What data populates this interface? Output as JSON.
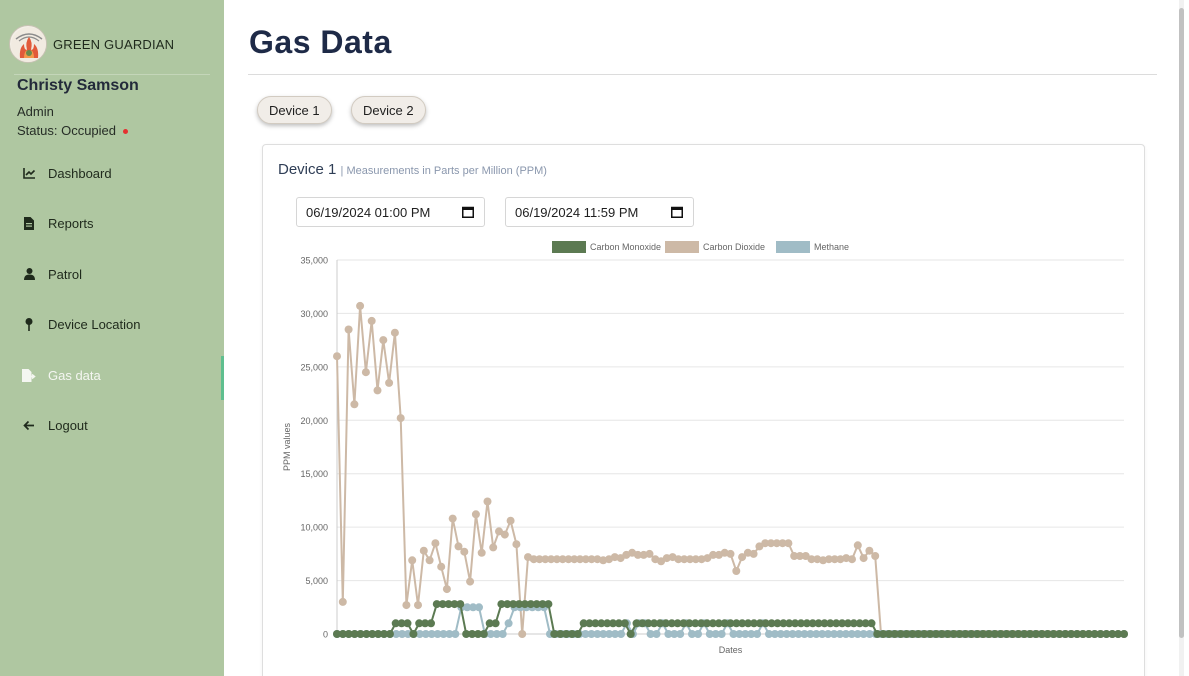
{
  "brand": {
    "name": "GREEN GUARDIAN"
  },
  "user": {
    "name": "Christy Samson",
    "role": "Admin",
    "status": "Status: Occupied"
  },
  "nav": [
    {
      "label": "Dashboard",
      "icon": "chart-line-icon"
    },
    {
      "label": "Reports",
      "icon": "document-icon"
    },
    {
      "label": "Patrol",
      "icon": "user-icon"
    },
    {
      "label": "Device Location",
      "icon": "map-pin-icon"
    },
    {
      "label": "Gas data",
      "icon": "file-export-icon",
      "active": true
    },
    {
      "label": "Logout",
      "icon": "arrow-left-icon"
    }
  ],
  "page": {
    "title": "Gas Data"
  },
  "devices": [
    "Device 1",
    "Device 2"
  ],
  "card": {
    "title": "Device 1",
    "subtitle": "Measurements in Parts per Million (PPM)"
  },
  "dates": {
    "start": "06/19/2024 01:00 PM",
    "end": "06/19/2024 11:59 PM"
  },
  "colors": {
    "sidebar": "#afc7a1",
    "co": "#5c7a52",
    "co2": "#cdb9a6",
    "methane": "#a0bcc6",
    "active_indicator": "#5fbf8f"
  },
  "chart_data": {
    "type": "line",
    "title": "",
    "xlabel": "Dates",
    "ylabel": "PPM values",
    "ylim": [
      0,
      35000
    ],
    "yticks": [
      0,
      5000,
      10000,
      15000,
      20000,
      25000,
      30000,
      35000
    ],
    "ytick_labels": [
      "0",
      "5,000",
      "10,000",
      "15,000",
      "20,000",
      "25,000",
      "30,000",
      "35,000"
    ],
    "grid": true,
    "legend": "top-center",
    "series": [
      {
        "name": "Carbon Monoxide",
        "color": "#5c7a52",
        "values": [
          0,
          0,
          0,
          0,
          0,
          0,
          0,
          0,
          0,
          0,
          1000,
          1000,
          1000,
          0,
          1000,
          1000,
          1000,
          2800,
          2800,
          2800,
          2800,
          2800,
          0,
          0,
          0,
          0,
          1000,
          1000,
          2800,
          2800,
          2800,
          2800,
          2800,
          2800,
          2800,
          2800,
          2800,
          0,
          0,
          0,
          0,
          0,
          1000,
          1000,
          1000,
          1000,
          1000,
          1000,
          1000,
          1000,
          0,
          1000,
          1000,
          1000,
          1000,
          1000,
          1000,
          1000,
          1000,
          1000,
          1000,
          1000,
          1000,
          1000,
          1000,
          1000,
          1000,
          1000,
          1000,
          1000,
          1000,
          1000,
          1000,
          1000,
          1000,
          1000,
          1000,
          1000,
          1000,
          1000,
          1000,
          1000,
          1000,
          1000,
          1000,
          1000,
          1000,
          1000,
          1000,
          1000,
          1000,
          1000,
          0,
          0,
          0,
          0,
          0,
          0,
          0,
          0,
          0,
          0,
          0,
          0,
          0,
          0,
          0,
          0,
          0,
          0,
          0,
          0,
          0,
          0,
          0,
          0,
          0,
          0,
          0,
          0,
          0,
          0,
          0,
          0,
          0,
          0,
          0,
          0,
          0,
          0,
          0,
          0,
          0,
          0,
          0
        ]
      },
      {
        "name": "Carbon Dioxide",
        "color": "#cdb9a6",
        "values": [
          26000,
          3000,
          28500,
          21500,
          30700,
          24500,
          29300,
          22800,
          27500,
          23500,
          28200,
          20200,
          2700,
          6900,
          2700,
          7800,
          6900,
          8500,
          6300,
          4200,
          10800,
          8200,
          7700,
          4900,
          11200,
          7600,
          12400,
          8100,
          9600,
          9300,
          10600,
          8400,
          0,
          7200,
          7000,
          7000,
          7000,
          7000,
          7000,
          7000,
          7000,
          7000,
          7000,
          7000,
          7000,
          7000,
          6900,
          7000,
          7200,
          7100,
          7400,
          7600,
          7400,
          7400,
          7500,
          7000,
          6800,
          7100,
          7200,
          7000,
          7000,
          7000,
          7000,
          7000,
          7100,
          7400,
          7400,
          7600,
          7500,
          5900,
          7200,
          7600,
          7500,
          8200,
          8500,
          8500,
          8500,
          8500,
          8500,
          7300,
          7300,
          7300,
          7000,
          7000,
          6900,
          7000,
          7000,
          7000,
          7100,
          7000,
          8300,
          7100,
          7800,
          7300,
          0,
          0,
          0,
          0,
          0,
          0,
          0,
          0,
          0,
          0,
          0,
          0,
          0,
          0,
          0,
          0,
          0,
          0,
          0,
          0,
          0,
          0,
          0,
          0,
          0,
          0,
          0,
          0,
          0,
          0,
          0,
          0,
          0,
          0,
          0,
          0,
          0,
          0,
          0,
          0,
          0,
          0,
          0
        ]
      },
      {
        "name": "Methane",
        "color": "#a0bcc6",
        "values": [
          0,
          0,
          0,
          0,
          0,
          0,
          0,
          0,
          0,
          0,
          0,
          0,
          0,
          0,
          0,
          0,
          0,
          0,
          0,
          0,
          0,
          2500,
          2500,
          2500,
          2500,
          0,
          0,
          0,
          0,
          1000,
          2500,
          2500,
          2500,
          2500,
          2500,
          2500,
          0,
          0,
          0,
          0,
          0,
          0,
          0,
          0,
          0,
          0,
          0,
          0,
          0,
          1000,
          0,
          1000,
          1000,
          0,
          0,
          1000,
          0,
          0,
          0,
          1000,
          0,
          0,
          1000,
          0,
          0,
          0,
          1000,
          0,
          0,
          0,
          0,
          0,
          1000,
          0,
          0,
          0,
          0,
          0,
          0,
          0,
          0,
          0,
          0,
          0,
          0,
          0,
          0,
          0,
          0,
          0,
          0,
          0,
          0,
          0,
          0,
          0,
          0,
          0,
          0,
          0,
          0,
          0,
          0,
          0,
          0,
          0,
          0,
          0,
          0,
          0,
          0,
          0,
          0,
          0,
          0,
          0,
          0,
          0,
          0,
          0,
          0,
          0,
          0,
          0,
          0,
          0,
          0,
          0,
          0,
          0,
          0,
          0,
          0,
          0
        ]
      }
    ]
  }
}
